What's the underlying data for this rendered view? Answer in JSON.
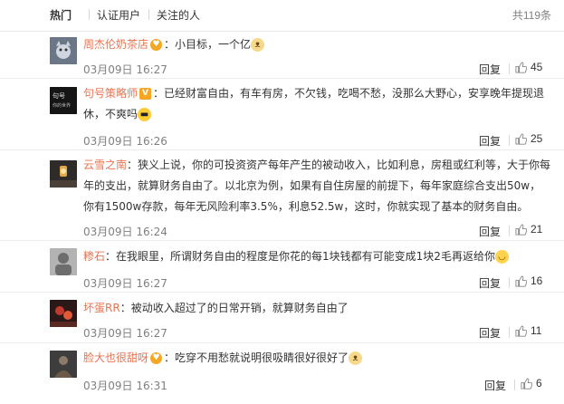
{
  "tabs": {
    "hot": "热门",
    "verified": "认证用户",
    "followed": "关注的人"
  },
  "total_count": "共119条",
  "reply_label": "回复",
  "colors": {
    "username": "#eb7350",
    "gold_badge": "#f5a623",
    "blue_badge": "#1a84e5",
    "timestamp": "#808080"
  },
  "comments": [
    {
      "username": "周杰伦奶茶店",
      "badge": "heart-badge",
      "sep": "：",
      "text": "小目标，一个亿",
      "emoji": "cat-emoji",
      "time": "03月09日 16:27",
      "likes": "45"
    },
    {
      "username": "句号策略师",
      "badge": "verified-v-badge",
      "sep": "：",
      "text": "已经财富自由，有车有房，不欠钱，吃喝不愁，没那么大野心，安享晚年提现退休，不爽吗",
      "emoji": "sunglasses-emoji",
      "avatar_text": "句号 | 你的世界",
      "time": "03月09日 16:26",
      "likes": "25"
    },
    {
      "username": "云雪之南",
      "badge": "",
      "sep": "：",
      "text": "狭义上说，你的可投资资产每年产生的被动收入，比如利息，房租或红利等，大于你每年的支出，就算财务自由了。以北京为例，如果有自住房屋的前提下，每年家庭综合支出50w，你有1500w存款，每年无风险利率3.5%，利息52.5w，这时，你就实现了基本的财务自由。",
      "emoji": "",
      "time": "03月09日 16:24",
      "likes": "21"
    },
    {
      "username": "糁石",
      "badge": "",
      "sep": "：",
      "text": "在我眼里，所谓财务自由的程度是你花的每1块钱都有可能变成1块2毛再返给你",
      "emoji": "smile-emoji",
      "time": "03月09日 16:27",
      "likes": "16"
    },
    {
      "username": "坏蛋RR",
      "badge": "",
      "sep": "：",
      "text": "被动收入超过了的日常开销，就算财务自由了",
      "emoji": "",
      "time": "03月09日 16:27",
      "likes": "11"
    },
    {
      "username": "脸大也很甜呀",
      "badge": "heart-badge",
      "sep": "：",
      "text": "吃穿不用愁就说明很吸睛很好很好了",
      "emoji": "cat-emoji",
      "time": "03月09日 16:31",
      "likes": "6"
    }
  ]
}
